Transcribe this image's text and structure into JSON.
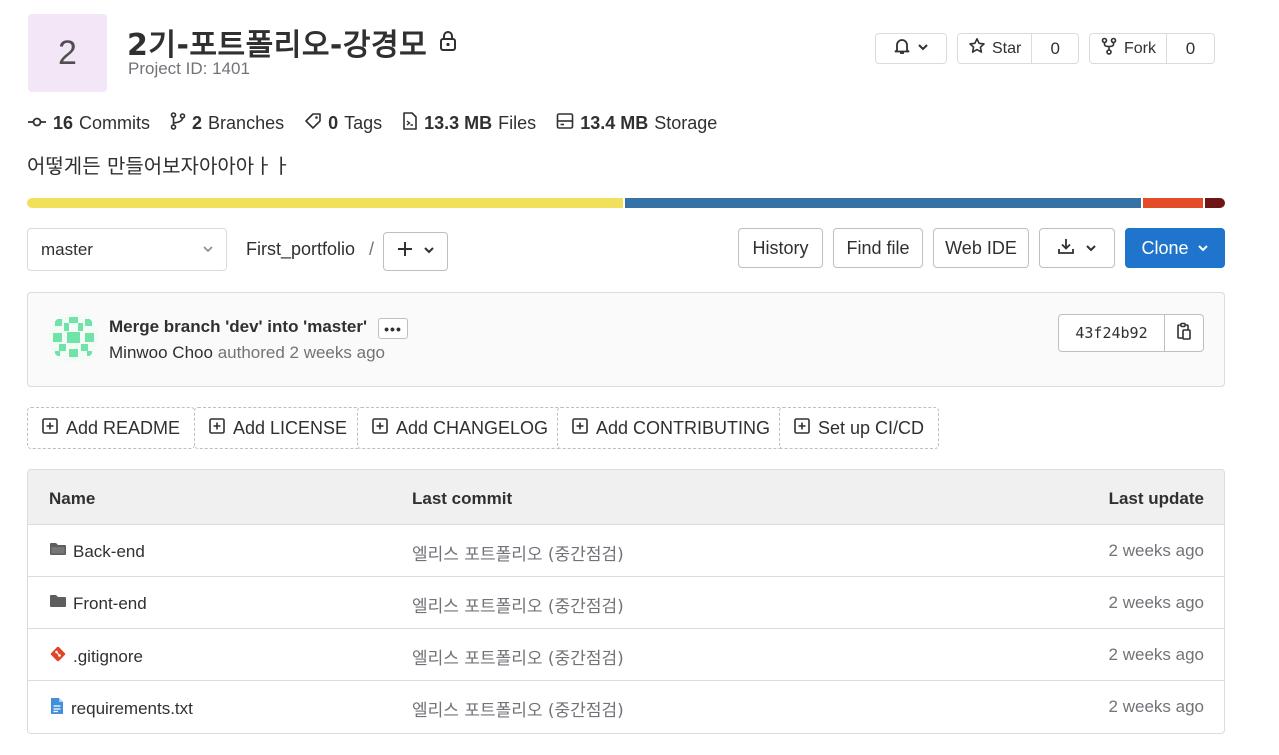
{
  "project": {
    "avatar_letter": "2",
    "title": "2기-포트폴리오-강경모",
    "id_text": "Project ID: 1401"
  },
  "header_actions": {
    "star_label": "Star",
    "star_count": "0",
    "fork_label": "Fork",
    "fork_count": "0"
  },
  "stats": [
    {
      "value": "16",
      "label": "Commits",
      "icon": "commit-icon"
    },
    {
      "value": "2",
      "label": "Branches",
      "icon": "branch-icon"
    },
    {
      "value": "0",
      "label": "Tags",
      "icon": "tag-icon"
    },
    {
      "value": "13.3 MB",
      "label": "Files",
      "icon": "file-icon"
    },
    {
      "value": "13.4 MB",
      "label": "Storage",
      "icon": "storage-icon"
    }
  ],
  "description": "어떻게든 만들어보자아아아ㅏㅏ",
  "languages": [
    {
      "color": "#f1e05a",
      "share": 50
    },
    {
      "color": "#3572a5",
      "share": 43.3
    },
    {
      "color": "#e34c26",
      "share": 5
    },
    {
      "color": "#701516",
      "share": 1.7
    }
  ],
  "toolbar": {
    "branch": "master",
    "breadcrumb_root": "First_portfolio",
    "breadcrumb_sep": "/",
    "history": "History",
    "find_file": "Find file",
    "web_ide": "Web IDE",
    "clone": "Clone"
  },
  "last_commit": {
    "title": "Merge branch 'dev' into 'master'",
    "ellipsis": "•••",
    "author": "Minwoo Choo",
    "meta": "authored 2 weeks ago",
    "sha": "43f24b92"
  },
  "quick_actions": [
    "Add README",
    "Add LICENSE",
    "Add CHANGELOG",
    "Add CONTRIBUTING",
    "Set up CI/CD"
  ],
  "table": {
    "headers": {
      "name": "Name",
      "last_commit": "Last commit",
      "last_update": "Last update"
    },
    "rows": [
      {
        "name": "Back-end",
        "type": "folder-icon",
        "commit": "엘리스 포트폴리오 (중간점검)",
        "updated": "2 weeks ago"
      },
      {
        "name": "Front-end",
        "type": "folder-icon",
        "commit": "엘리스 포트폴리오 (중간점검)",
        "updated": "2 weeks ago"
      },
      {
        "name": ".gitignore",
        "type": "git-icon",
        "commit": "엘리스 포트폴리오 (중간점검)",
        "updated": "2 weeks ago"
      },
      {
        "name": "requirements.txt",
        "type": "text-file-icon",
        "commit": "엘리스 포트폴리오 (중간점검)",
        "updated": "2 weeks ago"
      }
    ]
  }
}
